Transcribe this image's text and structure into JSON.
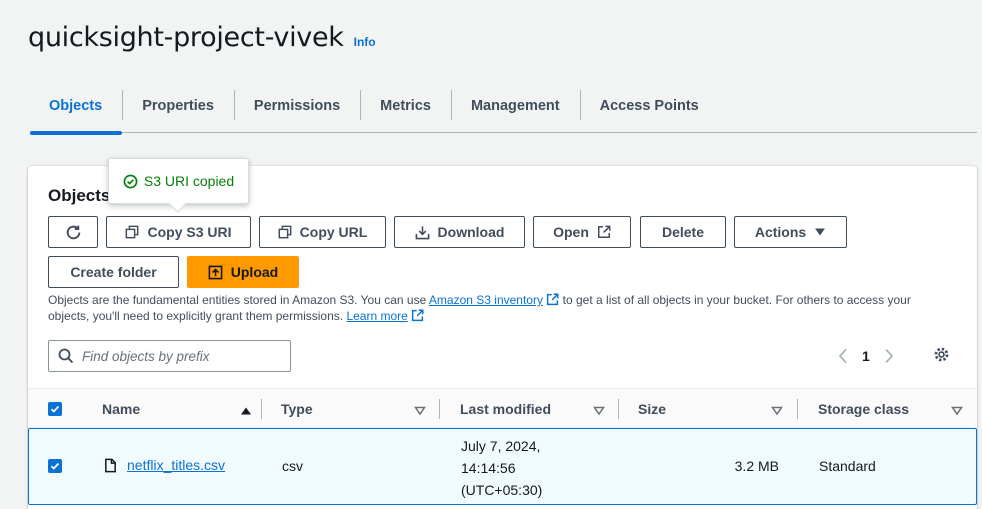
{
  "bucket": {
    "name": "quicksight-project-vivek",
    "info_label": "Info"
  },
  "tabs": [
    {
      "label": "Objects"
    },
    {
      "label": "Properties"
    },
    {
      "label": "Permissions"
    },
    {
      "label": "Metrics"
    },
    {
      "label": "Management"
    },
    {
      "label": "Access Points"
    }
  ],
  "panel": {
    "title": "Objects",
    "tooltip": "S3 URI copied",
    "buttons": {
      "copy_s3_uri": "Copy S3 URI",
      "copy_url": "Copy URL",
      "download": "Download",
      "open": "Open",
      "delete": "Delete",
      "actions": "Actions",
      "create_folder": "Create folder",
      "upload": "Upload"
    },
    "description": {
      "part1": "Objects are the fundamental entities stored in Amazon S3. You can use ",
      "inventory_link": "Amazon S3 inventory",
      "part2": " to get a list of all objects in your bucket. For others to access your objects, you'll need to explicitly grant them permissions. ",
      "learn_more": "Learn more"
    },
    "search_placeholder": "Find objects by prefix",
    "current_page": "1"
  },
  "table": {
    "columns": {
      "name": "Name",
      "type": "Type",
      "last_modified": "Last modified",
      "size": "Size",
      "storage_class": "Storage class"
    },
    "rows": [
      {
        "name": "netflix_titles.csv",
        "type": "csv",
        "last_modified_line1": "July 7, 2024,",
        "last_modified_line2": "14:14:56",
        "last_modified_line3": "(UTC+05:30)",
        "size": "3.2 MB",
        "storage_class": "Standard"
      }
    ]
  },
  "colors": {
    "accent": "#0972d3",
    "primary_button": "#ff9900",
    "success": "#037f0c"
  }
}
